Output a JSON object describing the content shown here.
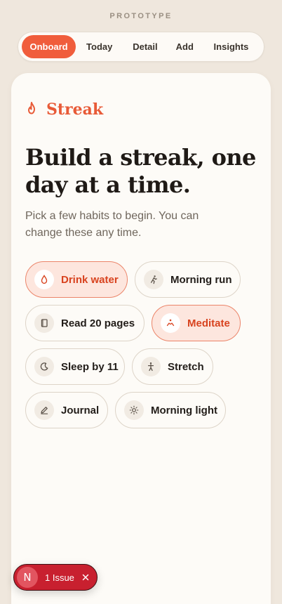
{
  "prototype_label": "PROTOTYPE",
  "tabs": [
    {
      "label": "Onboard",
      "active": true
    },
    {
      "label": "Today",
      "active": false
    },
    {
      "label": "Detail",
      "active": false
    },
    {
      "label": "Add",
      "active": false
    },
    {
      "label": "Insights",
      "active": false
    }
  ],
  "brand": {
    "name": "Streak",
    "icon": "flame-icon",
    "color": "#e85a37"
  },
  "headline": "Build a streak, one day at a time.",
  "subtitle": "Pick a few habits to begin. You can change these any time.",
  "habits": [
    {
      "label": "Drink water",
      "icon": "water-drop-icon",
      "selected": true
    },
    {
      "label": "Morning run",
      "icon": "running-icon",
      "selected": false
    },
    {
      "label": "Read 20 pages",
      "icon": "book-icon",
      "selected": false
    },
    {
      "label": "Meditate",
      "icon": "meditate-icon",
      "selected": true
    },
    {
      "label": "Sleep by 11",
      "icon": "moon-icon",
      "selected": false
    },
    {
      "label": "Stretch",
      "icon": "stretch-icon",
      "selected": false
    },
    {
      "label": "Journal",
      "icon": "pencil-icon",
      "selected": false
    },
    {
      "label": "Morning light",
      "icon": "sun-icon",
      "selected": false
    }
  ],
  "issues": {
    "badge": "N",
    "label": "1 Issue",
    "close_icon": "close-icon"
  },
  "colors": {
    "accent": "#f05d3c",
    "selected_bg": "#fde6de",
    "selected_border": "#eb8469",
    "issue_bg": "#c8202f"
  }
}
